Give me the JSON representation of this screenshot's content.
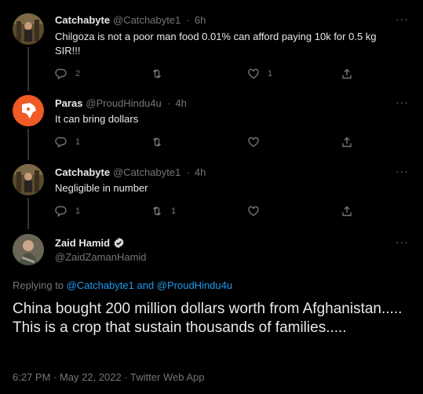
{
  "replies": [
    {
      "name": "Catchabyte",
      "handle": "@Catchabyte1",
      "time": "6h",
      "text": "Chilgoza is not a poor man food 0.01% can afford paying 10k for 0.5 kg SIR!!!",
      "reply_count": "2",
      "retweet_count": "",
      "like_count": "1"
    },
    {
      "name": "Paras",
      "handle": "@ProudHindu4u",
      "time": "4h",
      "text": "It can bring dollars",
      "reply_count": "1",
      "retweet_count": "",
      "like_count": ""
    },
    {
      "name": "Catchabyte",
      "handle": "@Catchabyte1",
      "time": "4h",
      "text": "Negligible in number",
      "reply_count": "1",
      "retweet_count": "1",
      "like_count": ""
    }
  ],
  "separator": "·",
  "more_label": "···",
  "main_tweet": {
    "name": "Zaid Hamid",
    "handle": "@ZaidZamanHamid",
    "replying_prefix": "Replying to ",
    "replying_user1": "@Catchabyte1",
    "replying_and": " and ",
    "replying_user2": "@ProudHindu4u",
    "text_line1": "China bought 200 million dollars worth from Afghanistan.....",
    "text_line2": "This is a crop that sustain thousands of families.....",
    "meta": "6:27 PM · May 22, 2022 · Twitter Web App"
  },
  "colors": {
    "background": "#000000",
    "text": "#e7e9ea",
    "muted": "#71767b",
    "link": "#1d9bf0",
    "verified": "#d9d9d9"
  },
  "icons": [
    "reply-icon",
    "retweet-icon",
    "like-icon",
    "share-icon",
    "verified-badge-icon",
    "more-icon"
  ]
}
